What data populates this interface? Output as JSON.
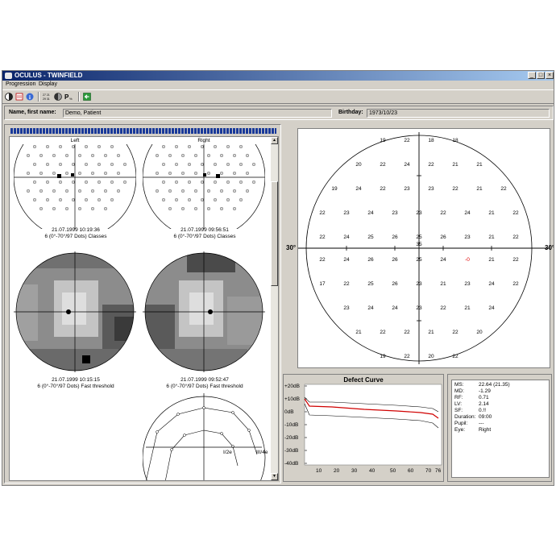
{
  "window": {
    "title": "OCULUS - TWINFIELD",
    "minimize": "_",
    "restore": "□",
    "close": "×"
  },
  "menu": {
    "progression": "Progression",
    "display": "Display"
  },
  "patient": {
    "name_label": "Name, first name:",
    "name_value": "Demo, Patient",
    "birthday_label": "Birthday:",
    "birthday_value": "1973/10/23"
  },
  "left_panel": {
    "col_left": "Left",
    "col_right": "Right",
    "exam1_left_date": "21.07.1999 10:19:36",
    "exam1_left_prog": "6 (0°-70°/97 Dots) Classes",
    "exam1_right_date": "21.07.1999 09:56:51",
    "exam1_right_prog": "6 (0°-70°/97 Dots) Classes",
    "exam2_left_date": "21.07.1999 10:15:15",
    "exam2_left_prog": "6 (0°-70°/97 Dots) Fast threshold",
    "exam2_right_date": "21.07.1999 09:52:47",
    "exam2_right_prog": "6 (0°-70°/97 Dots) Fast threshold",
    "isopter_label1": "I/2e",
    "isopter_label2": "III/4e"
  },
  "big_plot": {
    "left_degree": "30°",
    "right_degree": "30°",
    "center_value": "35",
    "rows": [
      [
        "19",
        "22",
        "18",
        "18"
      ],
      [
        "20",
        "22",
        "24",
        "22",
        "21",
        "21"
      ],
      [
        "19",
        "24",
        "22",
        "23",
        "23",
        "22",
        "21",
        "22"
      ],
      [
        "22",
        "23",
        "24",
        "23",
        "23",
        "22",
        "24",
        "21",
        "22"
      ],
      [
        "22",
        "24",
        "25",
        "26",
        "25",
        "26",
        "23",
        "21",
        "22"
      ],
      [
        "22",
        "24",
        "26",
        "26",
        "25",
        "24",
        "-0",
        "21",
        "22"
      ],
      [
        "17",
        "22",
        "25",
        "26",
        "23",
        "21",
        "23",
        "24",
        "22"
      ],
      [
        "23",
        "24",
        "24",
        "23",
        "22",
        "21",
        "24"
      ],
      [
        "21",
        "22",
        "22",
        "21",
        "22",
        "20"
      ],
      [
        "19",
        "22",
        "20",
        "22"
      ]
    ],
    "red_value": "-0"
  },
  "defect_curve": {
    "title": "Defect Curve",
    "y_ticks": [
      "+20dB",
      "+10dB",
      "0dB",
      "-10dB",
      "-20dB",
      "-30dB",
      "-40dB"
    ],
    "x_ticks": [
      "10",
      "20",
      "30",
      "40",
      "50",
      "60",
      "70",
      "76"
    ],
    "line_color": "#d00000"
  },
  "stats": [
    {
      "key": "MS:",
      "value": "22.64 (21.35)"
    },
    {
      "key": "MD:",
      "value": "-1.29"
    },
    {
      "key": "RF:",
      "value": "0.71"
    },
    {
      "key": "LV:",
      "value": "2.14"
    },
    {
      "key": "SF:",
      "value": "0.!!"
    },
    {
      "key": "Duration:",
      "value": "09:00"
    },
    {
      "key": "Pupil:",
      "value": "---"
    },
    {
      "key": "Eye:",
      "value": "Right"
    }
  ]
}
